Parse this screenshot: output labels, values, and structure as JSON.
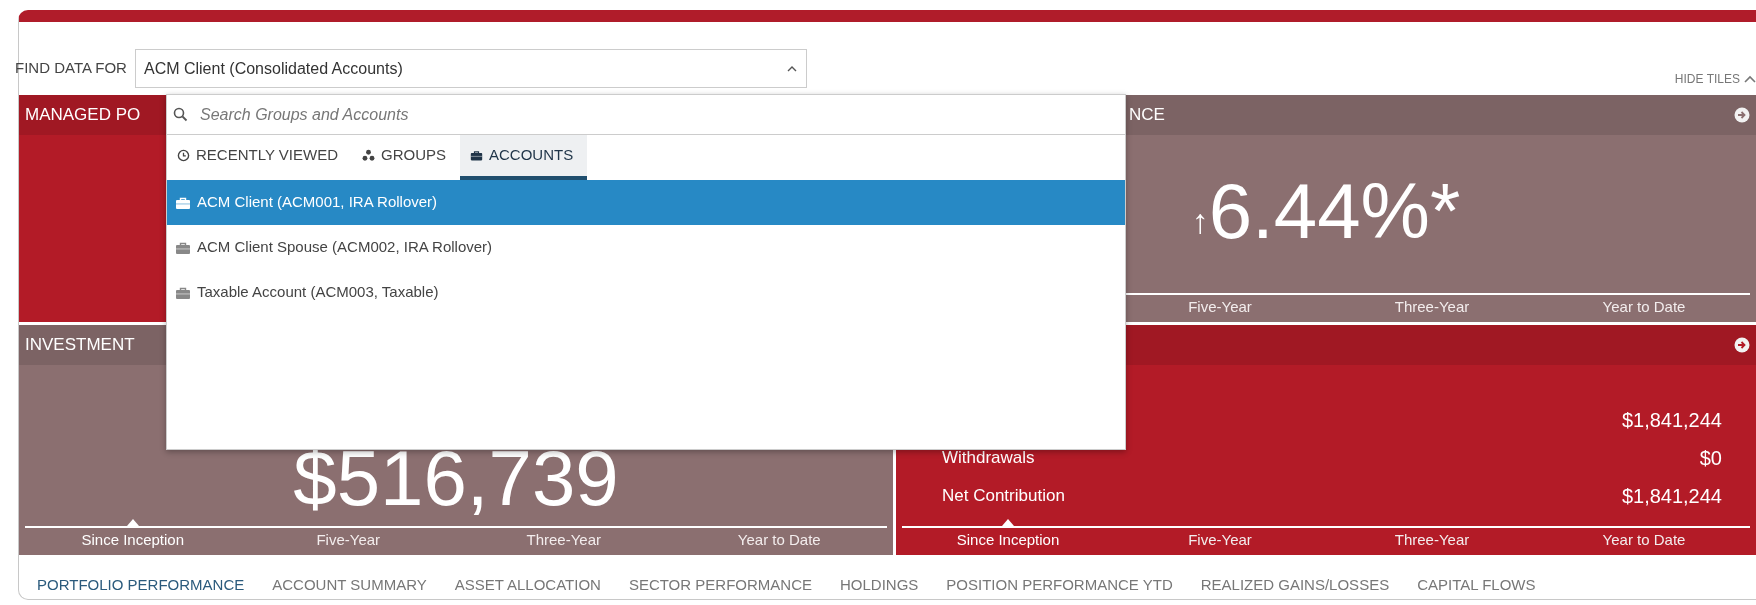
{
  "find_data": {
    "label": "FIND DATA FOR",
    "value": "ACM Client (Consolidated Accounts)",
    "expanded": true
  },
  "hide_tiles": "HIDE TILES",
  "dropdown": {
    "search_placeholder": "Search Groups and Accounts",
    "tabs": [
      {
        "label": "RECENTLY VIEWED",
        "selected": false
      },
      {
        "label": "GROUPS",
        "selected": false
      },
      {
        "label": "ACCOUNTS",
        "selected": true
      }
    ],
    "items": [
      {
        "label": "ACM Client (ACM001, IRA Rollover)",
        "selected": true
      },
      {
        "label": "ACM Client Spouse (ACM002, IRA Rollover)",
        "selected": false
      },
      {
        "label": "Taxable Account (ACM003, Taxable)",
        "selected": false
      }
    ]
  },
  "tiles": [
    {
      "kind": "blank",
      "title": "MANAGED PO",
      "color": "#b31b27"
    },
    {
      "kind": "big_value",
      "title": "NCE",
      "color": "#8b6f70",
      "link_icon": true,
      "arrow": "↑",
      "value": "6.44%*",
      "periods": [
        {
          "label": "Five-Year",
          "selected": false
        },
        {
          "label": "Three-Year",
          "selected": false
        },
        {
          "label": "Year to Date",
          "selected": false
        }
      ]
    },
    {
      "kind": "big_value",
      "title": "INVESTMENT",
      "color": "#8b6f70",
      "value": "$516,739",
      "periods": [
        {
          "label": "Since Inception",
          "selected": true
        },
        {
          "label": "Five-Year",
          "selected": false
        },
        {
          "label": "Three-Year",
          "selected": false
        },
        {
          "label": "Year to Date",
          "selected": false
        }
      ]
    },
    {
      "kind": "flows",
      "color": "#b31b27",
      "link_icon": true,
      "rows": [
        {
          "value": "$1,841,244"
        },
        {
          "label": "Withdrawals",
          "value": "$0"
        },
        {
          "label": "Net Contribution",
          "value": "$1,841,244"
        }
      ],
      "periods": [
        {
          "label": "Since Inception",
          "selected": true
        },
        {
          "label": "Five-Year",
          "selected": false
        },
        {
          "label": "Three-Year",
          "selected": false
        },
        {
          "label": "Year to Date",
          "selected": false
        }
      ]
    }
  ],
  "nav": [
    {
      "label": "PORTFOLIO PERFORMANCE",
      "selected": true
    },
    {
      "label": "ACCOUNT SUMMARY",
      "selected": false
    },
    {
      "label": "ASSET ALLOCATION",
      "selected": false
    },
    {
      "label": "SECTOR PERFORMANCE",
      "selected": false
    },
    {
      "label": "HOLDINGS",
      "selected": false
    },
    {
      "label": "POSITION PERFORMANCE YTD",
      "selected": false
    },
    {
      "label": "REALIZED GAINS/LOSSES",
      "selected": false
    },
    {
      "label": "CAPITAL FLOWS",
      "selected": false
    }
  ]
}
